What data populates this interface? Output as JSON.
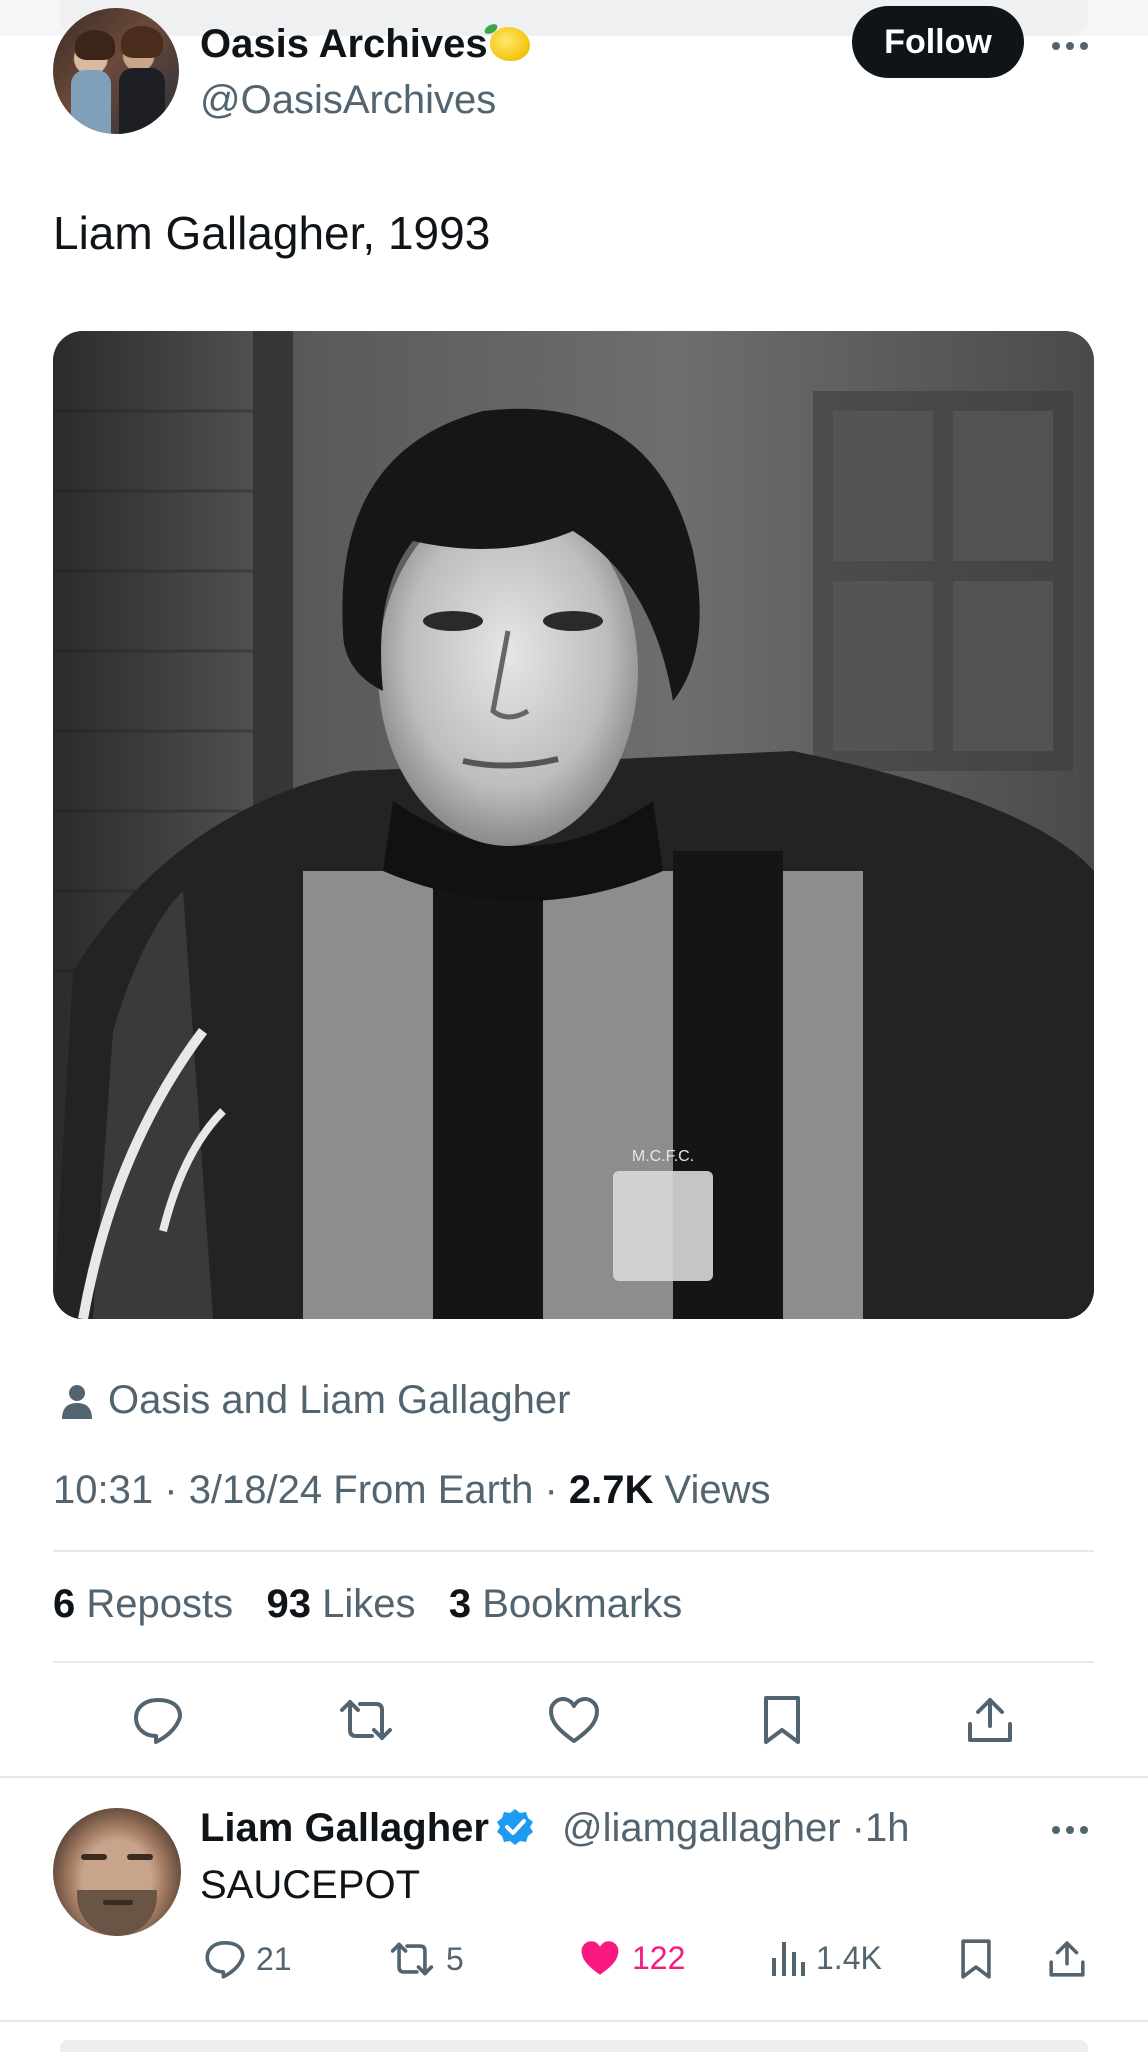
{
  "tweet": {
    "author_name": "Oasis Archives",
    "author_handle": "@OasisArchives",
    "follow_label": "Follow",
    "text": "Liam Gallagher, 1993",
    "tagged": "Oasis and Liam Gallagher",
    "time": "10:31",
    "date": "3/18/24",
    "source": "From Earth",
    "views_count": "2.7K",
    "views_label": "Views",
    "reposts_count": "6",
    "reposts_label": "Reposts",
    "likes_count": "93",
    "likes_label": "Likes",
    "bookmarks_count": "3",
    "bookmarks_label": "Bookmarks",
    "separator": "·"
  },
  "reply": {
    "author_name": "Liam Gallagher",
    "author_handle": "@liamgallagher",
    "time": "1h",
    "text": "SAUCEPOT",
    "comments": "21",
    "reposts": "5",
    "likes": "122",
    "views": "1.4K"
  },
  "colors": {
    "primary_text": "#0f1419",
    "secondary_text": "#536471",
    "like_pink": "#f91880",
    "verified_blue": "#1d9bf0"
  },
  "icons": {
    "reply": "comment-bubble-icon",
    "repost": "repost-icon",
    "like": "heart-icon",
    "bookmark": "bookmark-icon",
    "share": "share-upload-icon",
    "views": "bar-chart-icon",
    "tag": "person-icon",
    "more": "more-dots-icon",
    "verified": "verified-badge-icon"
  }
}
